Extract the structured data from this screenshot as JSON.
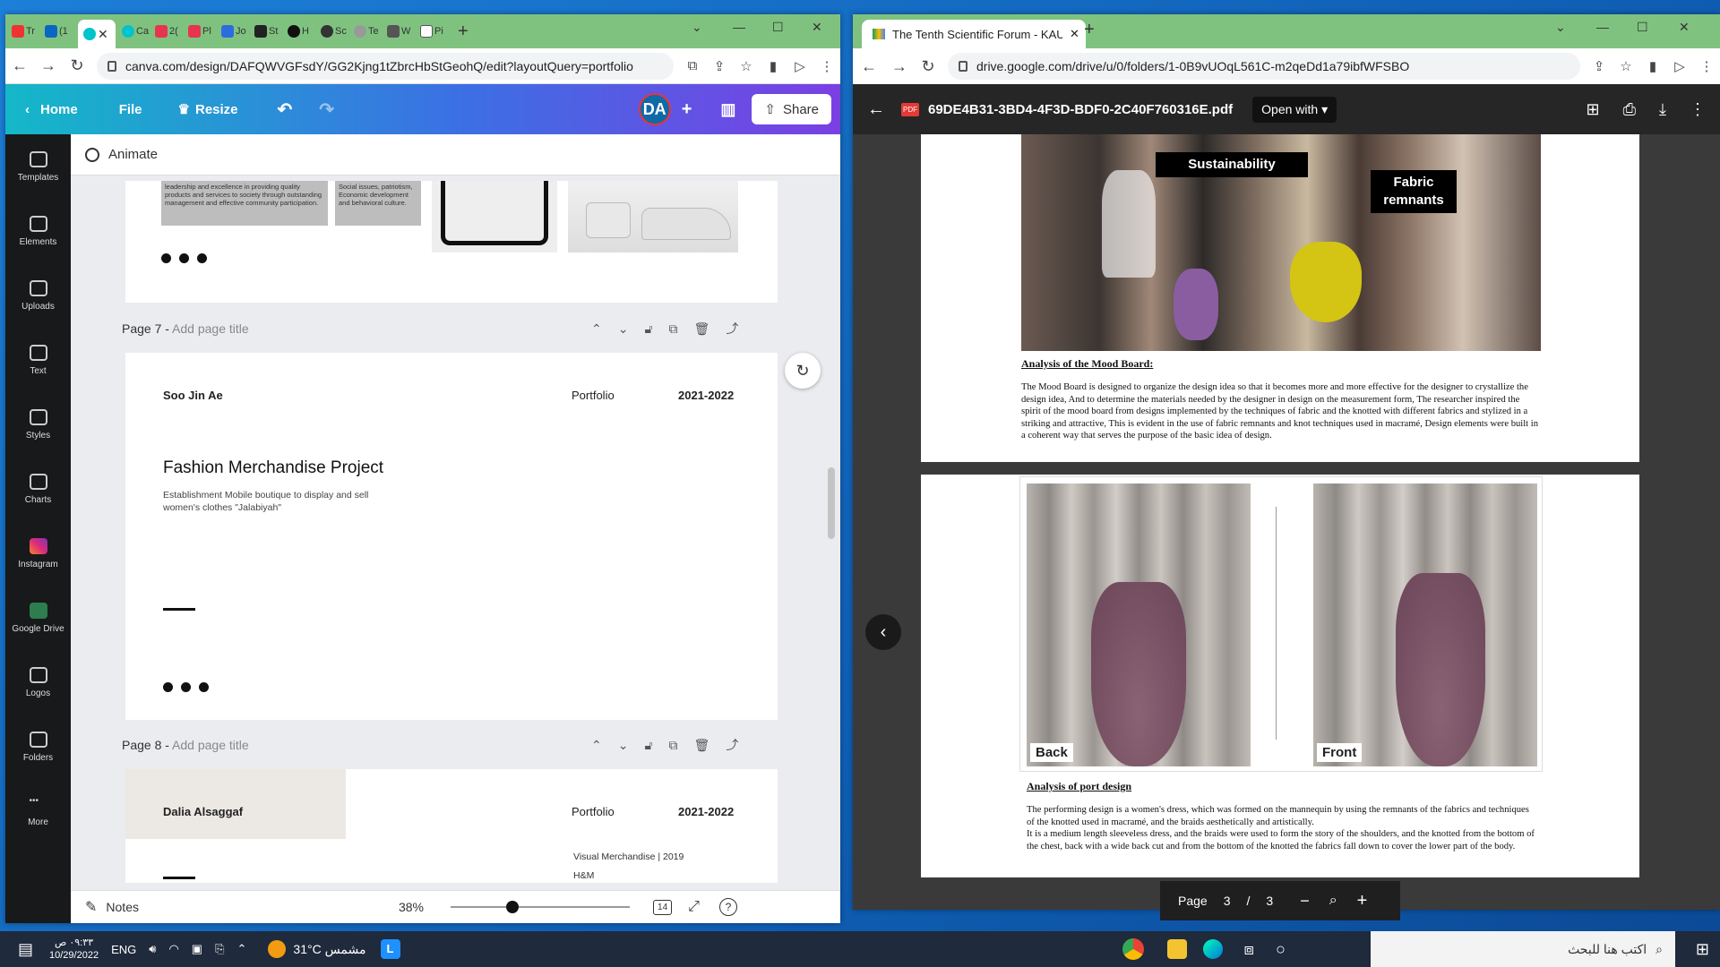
{
  "left_window": {
    "tabs": [
      "Tr",
      "(1",
      "",
      "Ca",
      "2(",
      "Pl",
      "Jo",
      "St",
      "H",
      "Sc",
      "Te",
      "W",
      "Pi"
    ],
    "url": "canva.com/design/DAFQWVGFsdY/GG2Kjng1tZbrcHbStGeohQ/edit?layoutQuery=portfolio",
    "header": {
      "home": "Home",
      "file": "File",
      "resize": "Resize",
      "avatar": "DA",
      "share": "Share"
    },
    "rail": [
      {
        "label": "Templates",
        "icon": "templates-icon"
      },
      {
        "label": "Elements",
        "icon": "elements-icon"
      },
      {
        "label": "Uploads",
        "icon": "uploads-icon"
      },
      {
        "label": "Text",
        "icon": "text-icon"
      },
      {
        "label": "Styles",
        "icon": "styles-icon"
      },
      {
        "label": "Charts",
        "icon": "charts-icon"
      },
      {
        "label": "Instagram",
        "icon": "instagram-icon"
      },
      {
        "label": "Google Drive",
        "icon": "google-drive-icon"
      },
      {
        "label": "Logos",
        "icon": "logos-icon"
      },
      {
        "label": "Folders",
        "icon": "folders-icon"
      },
      {
        "label": "More",
        "icon": "more-icon"
      }
    ],
    "animate": "Animate",
    "top_snippet": {
      "text1": "leadership and excellence in providing quality products and services to society through outstanding management and effective community participation.",
      "text2": "Social issues, patriotism, Economic development and behavioral culture."
    },
    "page7": {
      "label": "Page 7 - ",
      "add_title": "Add page title",
      "name": "Soo Jin Ae",
      "portfolio": "Portfolio",
      "year": "2021-2022",
      "project_title": "Fashion Merchandise Project",
      "project_desc": "Establishment Mobile boutique to display and sell women's clothes \"Jalabiyah\""
    },
    "page8": {
      "label": "Page 8 - ",
      "add_title": "Add page title",
      "name": "Dalia Alsaggaf",
      "portfolio": "Portfolio",
      "year": "2021-2022",
      "vm": "Visual Merchandise |  2019",
      "hm": "H&M"
    },
    "bottom": {
      "notes": "Notes",
      "zoom": "38%",
      "page_count": "14"
    }
  },
  "right_window": {
    "tab_title": "The Tenth Scientific Forum - KAU",
    "url": "drive.google.com/drive/u/0/folders/1-0B9vUOqL561C-m2qeDd1a79ibfWFSBO",
    "pdf_name": "69DE4B31-3BD4-4F3D-BDF0-2C40F760316E.pdf",
    "open_with": "Open with",
    "mood_tags": {
      "sustainability": "Sustainability",
      "fabric": "Fabric remnants"
    },
    "mood_heading": "Analysis of the Mood Board:",
    "mood_text": "The Mood Board is designed to organize the design idea so that it becomes more and more effective for the designer to crystallize the design idea, And to determine the materials needed by the designer in design on the measurement form, The researcher inspired the spirit of the mood board from designs implemented by the techniques of fabric and the knotted with different fabrics and stylized in a striking and attractive, This is evident in the use of fabric remnants and knot techniques used in macramé, Design elements were built in a coherent way that serves the purpose of the basic idea of design.",
    "photo_labels": {
      "back": "Back",
      "front": "Front"
    },
    "port_heading": "Analysis of port design",
    "port_text1": "The performing design is a women's dress, which was formed on the mannequin by using the remnants of the fabrics and techniques of the knotted used in macramé, and the braids aesthetically and artistically.",
    "port_text2": "It is a medium length sleeveless dress, and the braids were used to form the story of the shoulders, and the knotted from the bottom of the chest, back with a wide back cut and from the bottom of the knotted  the fabrics fall down to cover the lower part of the body.",
    "page_ctl": {
      "label": "Page",
      "current": "3",
      "sep": "/",
      "total": "3"
    }
  },
  "taskbar": {
    "time": "٠٩:٣٣ ص",
    "date": "10/29/2022",
    "lang": "ENG",
    "weather": "31°C  مشمس",
    "search": "اكتب هنا للبحث"
  },
  "colors": {
    "canva_gradient_start": "#14b8c8",
    "canva_gradient_end": "#7b3fe4",
    "tab_strip": "#7fc27f"
  }
}
